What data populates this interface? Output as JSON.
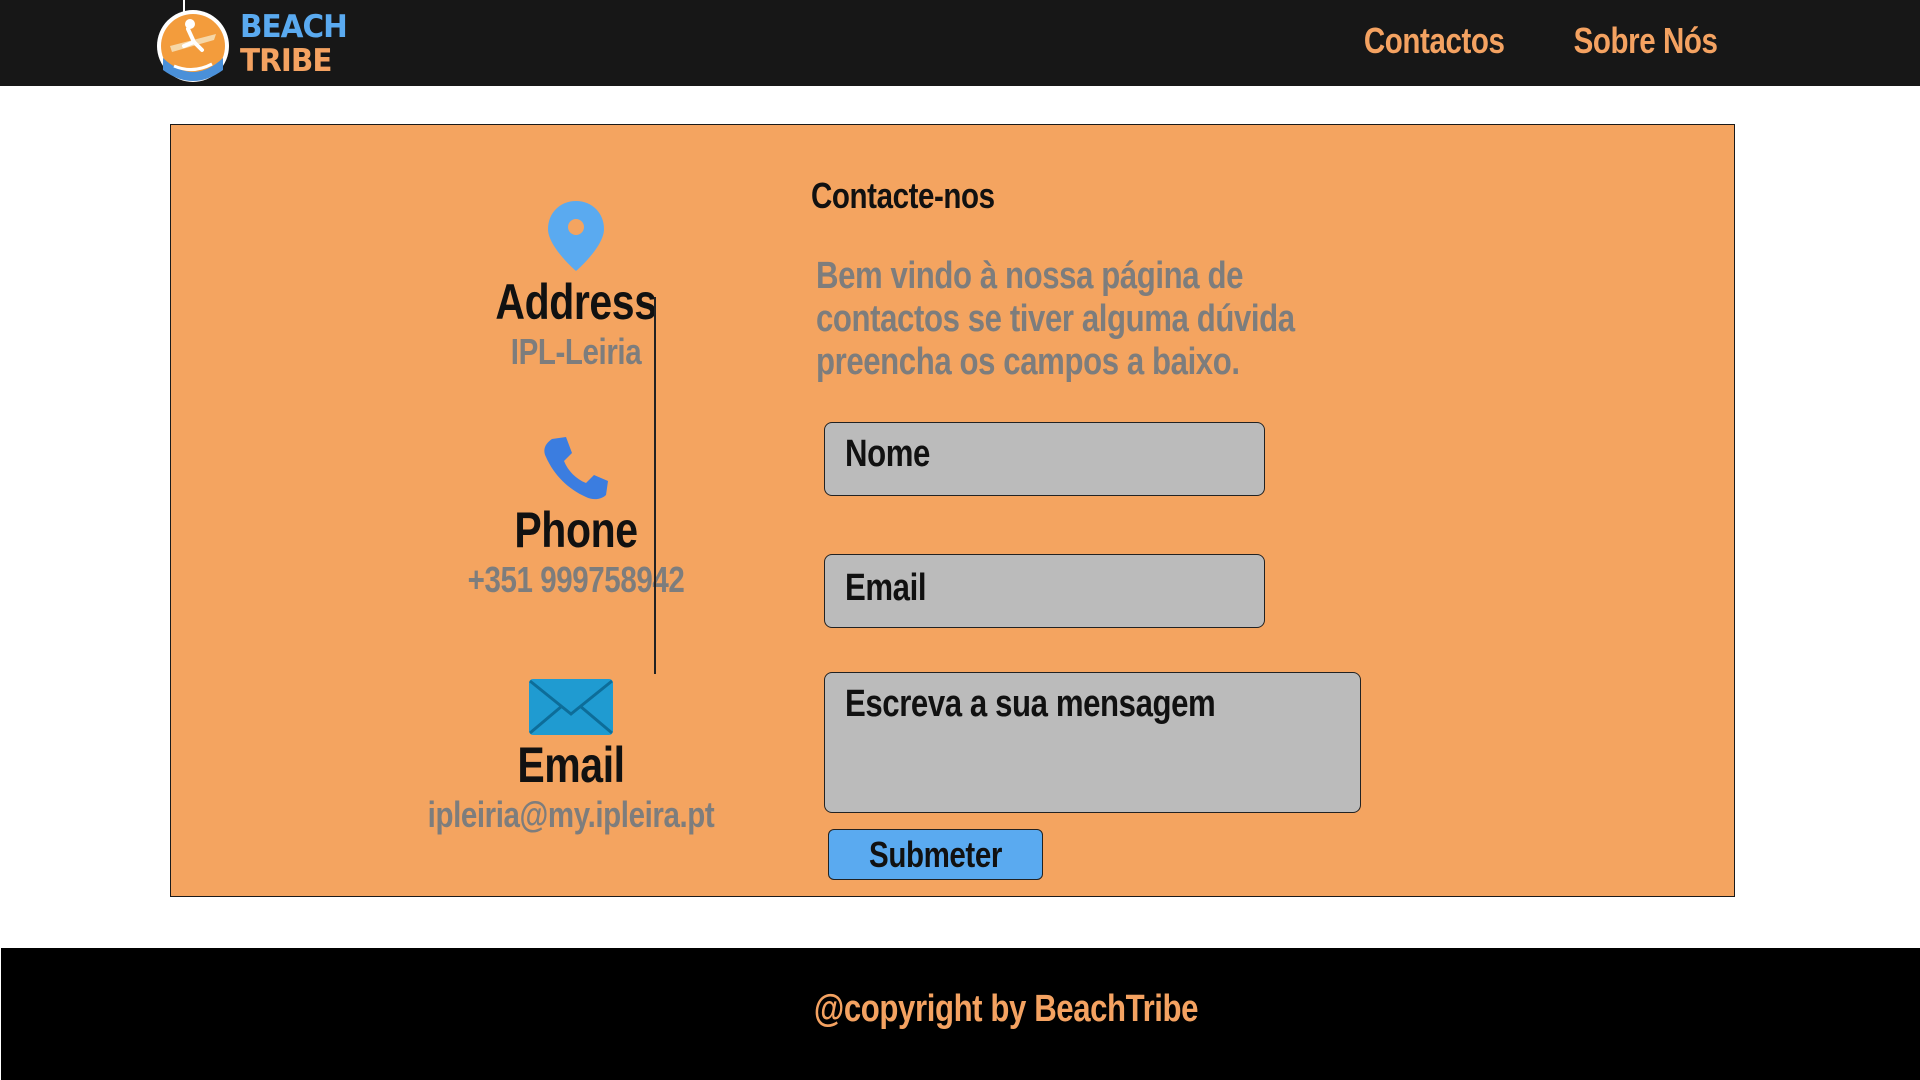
{
  "brand": {
    "logo_line1": "BEACH",
    "logo_line2": "TRIBE",
    "colors": {
      "orange": "#f4a261",
      "blue": "#5aaaf0",
      "panel": "#f4a460",
      "nav_bg": "#171717"
    }
  },
  "nav": {
    "links": [
      {
        "label": "Contactos"
      },
      {
        "label": "Sobre Nós"
      }
    ]
  },
  "contact_info": {
    "address": {
      "icon": "map-pin-icon",
      "title": "Address",
      "value": "IPL-Leiria"
    },
    "phone": {
      "icon": "phone-icon",
      "title": "Phone",
      "value": "+351 999758942"
    },
    "email": {
      "icon": "envelope-icon",
      "title": "Email",
      "value": "ipleiria@my.ipleira.pt"
    }
  },
  "form": {
    "heading": "Contacte-nos",
    "intro": "Bem vindo à nossa página de contactos se tiver alguma dúvida preencha os campos a baixo.",
    "name_placeholder": "Nome",
    "email_placeholder": "Email",
    "message_placeholder": "Escreva a sua mensagem",
    "submit_label": "Submeter"
  },
  "footer": {
    "text": "@copyright by BeachTribe"
  }
}
